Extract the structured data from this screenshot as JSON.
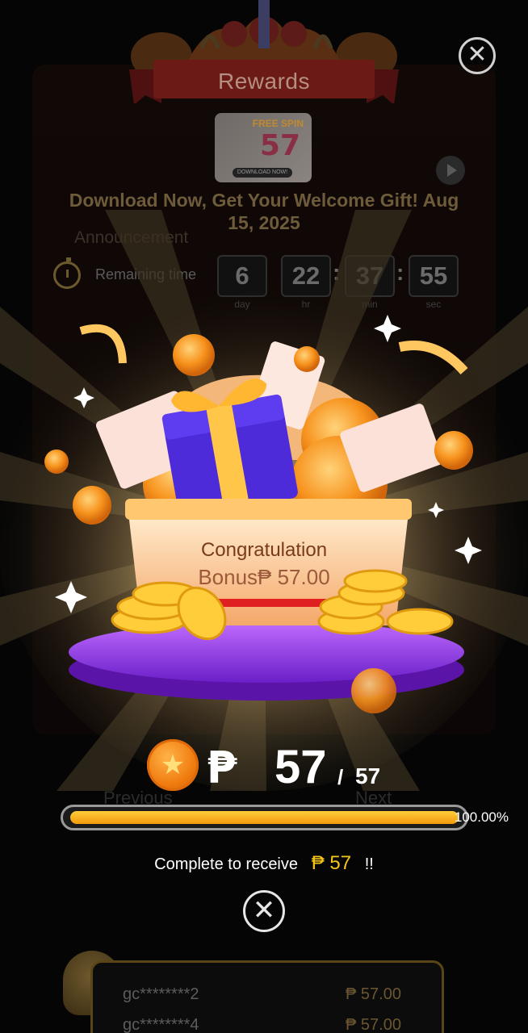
{
  "header": {
    "title": "Rewards",
    "close_icon": "close-icon"
  },
  "promo": {
    "thumbnail_badge": "FREE SPIN",
    "thumbnail_amount": "57",
    "thumbnail_button": "DOWNLOAD NOW!",
    "headline": "Download Now, Get Your Welcome Gift! Aug 15, 2025",
    "subline": "Announcement"
  },
  "countdown": {
    "label": "Remaining time",
    "day": "6",
    "hr": "22",
    "min": "37",
    "sec": "55",
    "units": {
      "day": "day",
      "hr": "hr",
      "min": "min",
      "sec": "sec"
    }
  },
  "background_nav": {
    "previous": "Previous",
    "next": "Next"
  },
  "leaderboard": [
    {
      "user": "gc********2",
      "amount": "₱ 57.00"
    },
    {
      "user": "gc********4",
      "amount": "₱ 57.00"
    }
  ],
  "modal": {
    "congrats": "Congratulation",
    "bonus": "Bonus₱ 57.00",
    "currency_symbol": "₱",
    "amount": "57",
    "separator": "/",
    "target": "57",
    "progress_percent": 100,
    "progress_label": "100.00%",
    "complete_text": "Complete to receive",
    "complete_amount": "₱ 57",
    "complete_suffix": "!!"
  },
  "colors": {
    "gold": "#f5c518",
    "purple": "#8a2be2",
    "orange": "#f07b0f"
  }
}
